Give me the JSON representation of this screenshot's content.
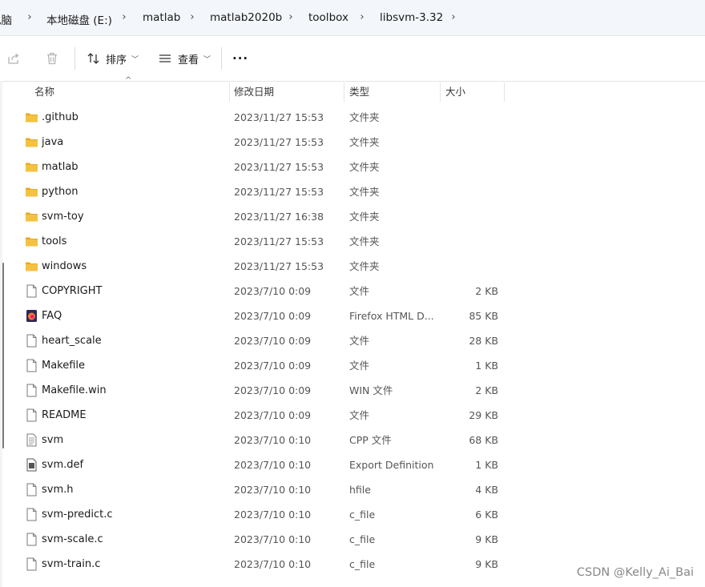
{
  "breadcrumb": {
    "items": [
      "电脑",
      "本地磁盘 (E:)",
      "matlab",
      "matlab2020b",
      "toolbox",
      "libsvm-3.32"
    ]
  },
  "toolbar": {
    "sort_label": "排序",
    "view_label": "查看",
    "more_label": "···"
  },
  "columns": {
    "name": "名称",
    "date": "修改日期",
    "type": "类型",
    "size": "大小"
  },
  "files": [
    {
      "name": ".github",
      "date": "2023/11/27 15:53",
      "type": "文件夹",
      "size": "",
      "icon": "folder-icon"
    },
    {
      "name": "java",
      "date": "2023/11/27 15:53",
      "type": "文件夹",
      "size": "",
      "icon": "folder-icon"
    },
    {
      "name": "matlab",
      "date": "2023/11/27 15:53",
      "type": "文件夹",
      "size": "",
      "icon": "folder-icon"
    },
    {
      "name": "python",
      "date": "2023/11/27 15:53",
      "type": "文件夹",
      "size": "",
      "icon": "folder-icon"
    },
    {
      "name": "svm-toy",
      "date": "2023/11/27 16:38",
      "type": "文件夹",
      "size": "",
      "icon": "folder-icon"
    },
    {
      "name": "tools",
      "date": "2023/11/27 15:53",
      "type": "文件夹",
      "size": "",
      "icon": "folder-icon"
    },
    {
      "name": "windows",
      "date": "2023/11/27 15:53",
      "type": "文件夹",
      "size": "",
      "icon": "folder-icon"
    },
    {
      "name": "COPYRIGHT",
      "date": "2023/7/10 0:09",
      "type": "文件",
      "size": "2 KB",
      "icon": "file-icon"
    },
    {
      "name": "FAQ",
      "date": "2023/7/10 0:09",
      "type": "Firefox HTML D...",
      "size": "85 KB",
      "icon": "firefox-html-icon"
    },
    {
      "name": "heart_scale",
      "date": "2023/7/10 0:09",
      "type": "文件",
      "size": "28 KB",
      "icon": "file-icon"
    },
    {
      "name": "Makefile",
      "date": "2023/7/10 0:09",
      "type": "文件",
      "size": "1 KB",
      "icon": "file-icon"
    },
    {
      "name": "Makefile.win",
      "date": "2023/7/10 0:09",
      "type": "WIN 文件",
      "size": "2 KB",
      "icon": "file-icon"
    },
    {
      "name": "README",
      "date": "2023/7/10 0:09",
      "type": "文件",
      "size": "29 KB",
      "icon": "file-icon"
    },
    {
      "name": "svm",
      "date": "2023/7/10 0:10",
      "type": "CPP 文件",
      "size": "68 KB",
      "icon": "text-file-icon"
    },
    {
      "name": "svm.def",
      "date": "2023/7/10 0:10",
      "type": "Export Definition...",
      "size": "1 KB",
      "icon": "def-file-icon"
    },
    {
      "name": "svm.h",
      "date": "2023/7/10 0:10",
      "type": "hfile",
      "size": "4 KB",
      "icon": "file-icon"
    },
    {
      "name": "svm-predict.c",
      "date": "2023/7/10 0:10",
      "type": "c_file",
      "size": "6 KB",
      "icon": "file-icon"
    },
    {
      "name": "svm-scale.c",
      "date": "2023/7/10 0:10",
      "type": "c_file",
      "size": "9 KB",
      "icon": "file-icon"
    },
    {
      "name": "svm-train.c",
      "date": "2023/7/10 0:10",
      "type": "c_file",
      "size": "9 KB",
      "icon": "file-icon"
    }
  ],
  "watermark": "CSDN @Kelly_Ai_Bai",
  "colors": {
    "folder": "#f5c142",
    "folder_dark": "#e8a91f",
    "address_bg": "#f3f6fa"
  }
}
